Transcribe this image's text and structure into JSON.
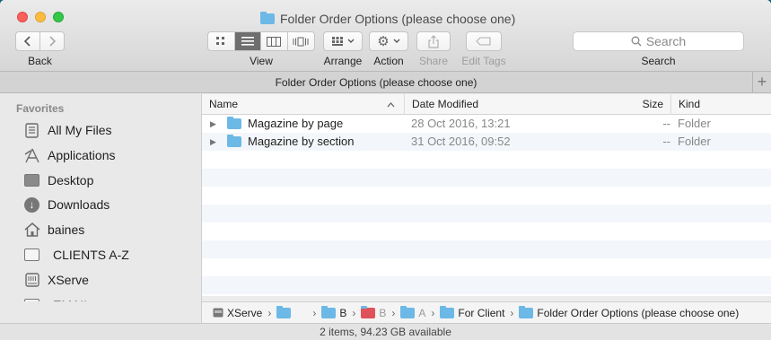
{
  "window": {
    "title": "Folder Order Options (please choose one)"
  },
  "toolbar": {
    "back_label": "Back",
    "view_label": "View",
    "arrange_label": "Arrange",
    "action_label": "Action",
    "share_label": "Share",
    "edit_tags_label": "Edit Tags",
    "search_label": "Search",
    "search_placeholder": "Search"
  },
  "tab": {
    "title": "Folder Order Options (please choose one)",
    "add_label": "+"
  },
  "sidebar": {
    "heading": "Favorites",
    "items": [
      {
        "label": "All My Files",
        "icon": "all-my-files-icon"
      },
      {
        "label": "Applications",
        "icon": "applications-icon"
      },
      {
        "label": "Desktop",
        "icon": "desktop-icon"
      },
      {
        "label": "Downloads",
        "icon": "downloads-icon"
      },
      {
        "label": "baines",
        "icon": "home-icon"
      },
      {
        "label": "CLIENTS A-Z",
        "icon": "folder-icon"
      },
      {
        "label": "XServe",
        "icon": "server-icon"
      },
      {
        "label": "EMAIL",
        "icon": "folder-icon"
      }
    ]
  },
  "list": {
    "columns": {
      "name": "Name",
      "date_modified": "Date Modified",
      "size": "Size",
      "kind": "Kind"
    },
    "rows": [
      {
        "name": "Magazine by page",
        "date": "28 Oct 2016, 13:21",
        "size": "--",
        "kind": "Folder"
      },
      {
        "name": "Magazine by section",
        "date": "31 Oct 2016, 09:52",
        "size": "--",
        "kind": "Folder"
      }
    ]
  },
  "pathbar": {
    "segments": [
      "XServe",
      "B",
      "B",
      "A",
      "For Client",
      "Folder Order Options (please choose one)"
    ]
  },
  "status": {
    "text": "2 items, 94.23 GB available"
  },
  "colors": {
    "folder_blue": "#6cb8e6",
    "folder_red": "#e0525a",
    "selected_segment": "#6e6e6e"
  }
}
